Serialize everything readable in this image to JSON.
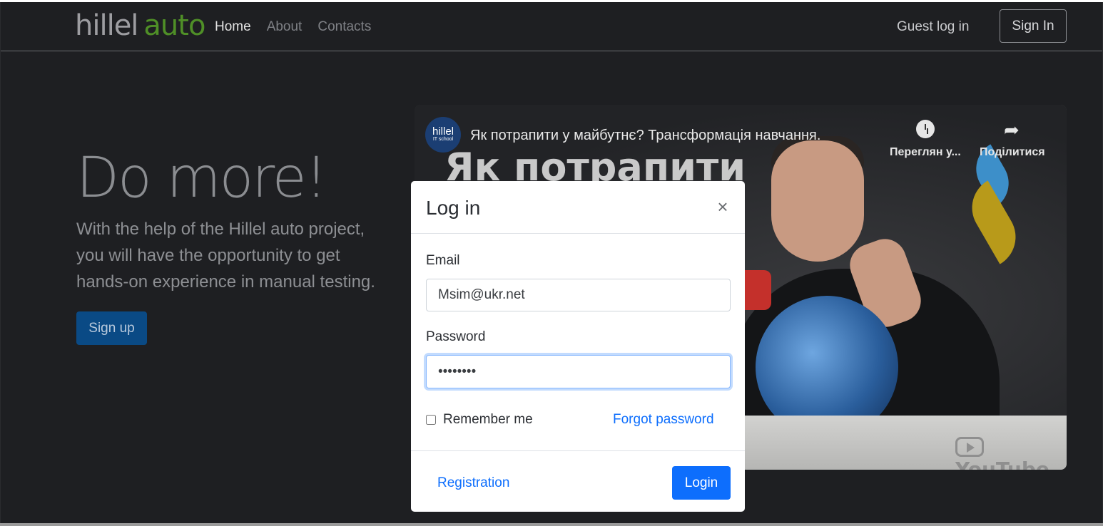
{
  "header": {
    "logo_part1": "hillel",
    "logo_part2": "auto",
    "nav": [
      {
        "label": "Home"
      },
      {
        "label": "About"
      },
      {
        "label": "Contacts"
      }
    ],
    "guest_login": "Guest log in",
    "sign_in": "Sign In"
  },
  "hero": {
    "title": "Do more!",
    "text": "With the help of the Hillel auto project, you will have the opportunity to get hands-on experience in manual testing.",
    "signup": "Sign up"
  },
  "video": {
    "channel": "hillel",
    "channel_sub": "IT school",
    "title": "Як потрапити у майбутнє? Трансформація навчання.",
    "overlay_text": "Як потрапити",
    "watch_later": "Переглян у...",
    "share": "Поділитися",
    "youtube": "YouTube"
  },
  "modal": {
    "title": "Log in",
    "close": "×",
    "email_label": "Email",
    "email_value": "Msim@ukr.net",
    "password_label": "Password",
    "password_value": "••••••••",
    "remember_label": "Remember me",
    "forgot": "Forgot password",
    "registration": "Registration",
    "login": "Login"
  },
  "colors": {
    "accent": "#0d6efd",
    "brand_green": "#4f8f27",
    "background": "#1e1f22"
  }
}
